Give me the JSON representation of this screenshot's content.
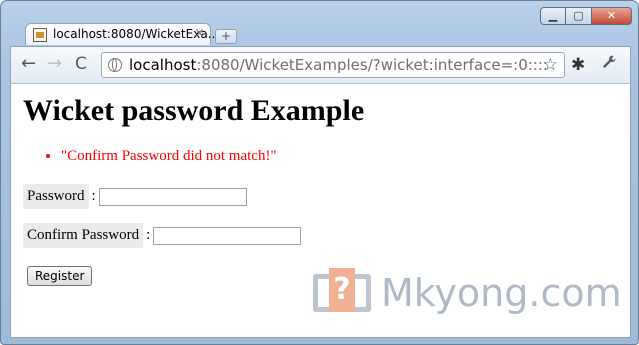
{
  "browser": {
    "tab_title": "localhost:8080/WicketExa...",
    "tab_close": "×",
    "new_tab": "+",
    "window_buttons": {
      "minimize": "▁",
      "maximize": "▢",
      "close": "✕"
    },
    "nav": {
      "back": "←",
      "forward": "→",
      "reload": "C"
    },
    "url_host": "localhost",
    "url_rest": ":8080/WicketExamples/?wicket:interface=:0::::",
    "bookmark_star": "☆",
    "extension_icon": "✱",
    "wrench": "🔧"
  },
  "page": {
    "title": "Wicket password Example",
    "feedback": [
      "\"Confirm Password did not match!\""
    ],
    "password_label": "Password",
    "confirm_label": "Confirm Password",
    "separator": ":",
    "register_label": "Register"
  },
  "watermark": {
    "logo_char": "?",
    "text": "Mkyong.com"
  },
  "colors": {
    "error": "#ff0000",
    "label_bg": "#ebebeb"
  },
  "icons": [
    "favicon-icon",
    "close-icon",
    "new-tab-icon",
    "back-icon",
    "forward-icon",
    "reload-icon",
    "globe-icon",
    "star-icon",
    "extension-icon",
    "wrench-icon"
  ]
}
